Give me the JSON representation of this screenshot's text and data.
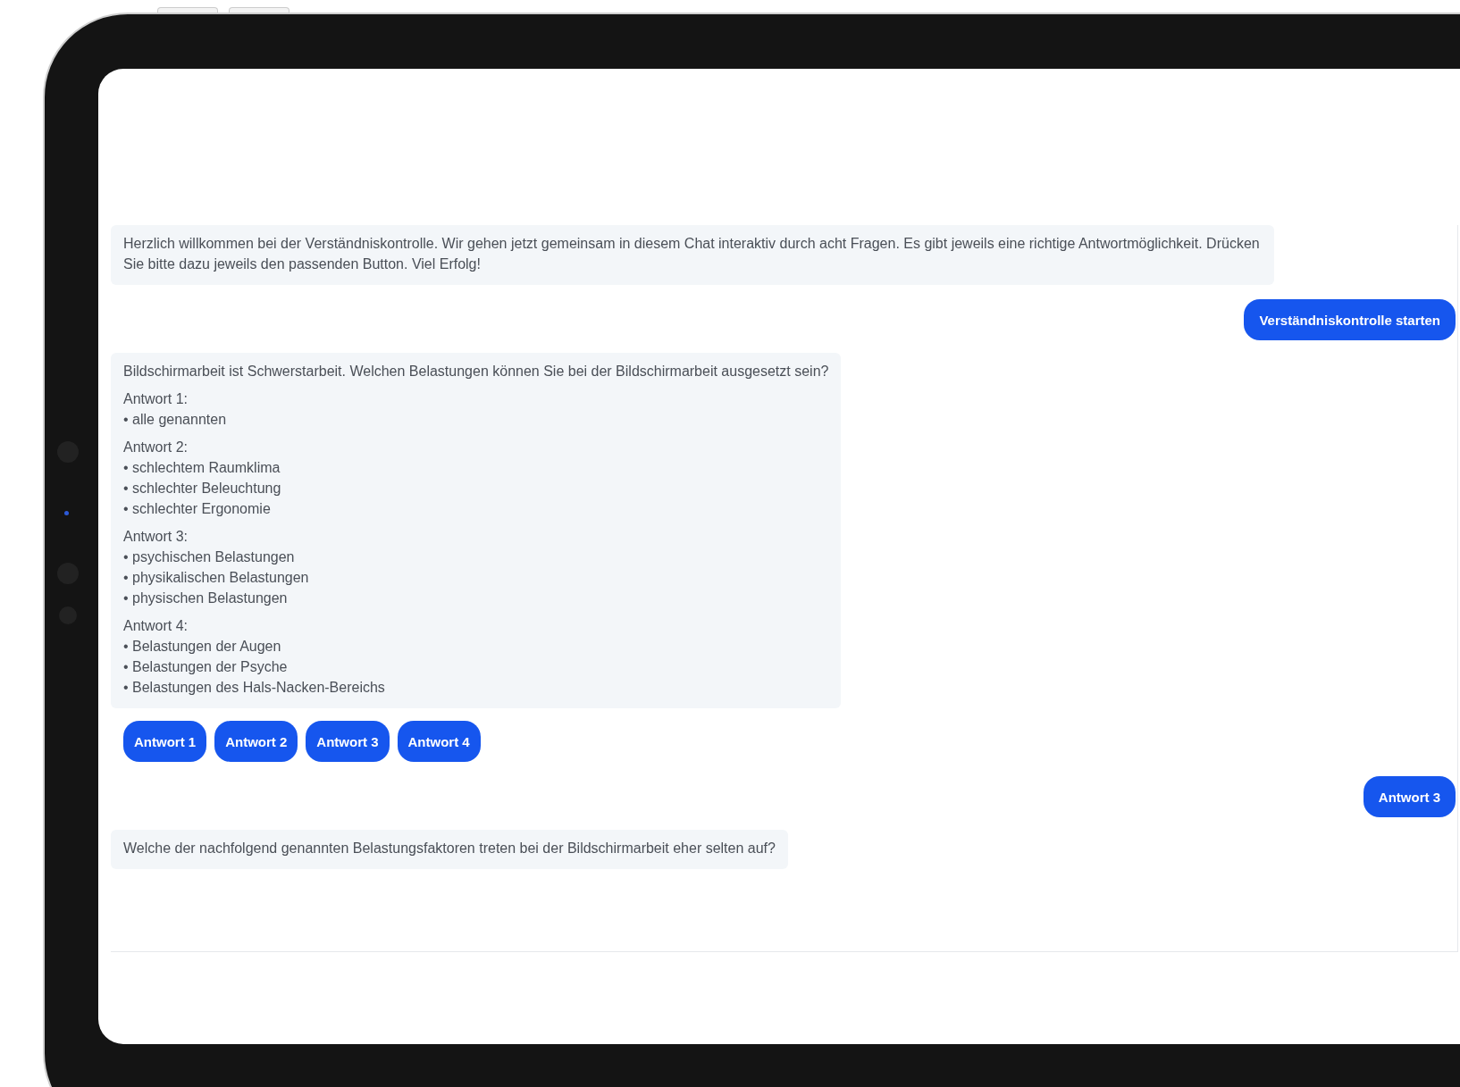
{
  "chat": {
    "messages": [
      {
        "kind": "intro",
        "text": "Herzlich willkommen bei der Verständniskontrolle. Wir gehen jetzt gemeinsam in diesem Chat interaktiv durch acht Fragen. Es gibt jeweils eine richtige Antwortmöglichkeit. Drücken Sie bitte dazu jeweils den passenden Button. Viel Erfolg!"
      },
      {
        "kind": "user",
        "text": "Verständniskontrolle starten"
      },
      {
        "kind": "question",
        "text": "Bildschirmarbeit ist Schwerstarbeit. Welchen Belastungen können Sie bei der Bildschirmarbeit ausgesetzt sein?",
        "answers": [
          {
            "label": "Antwort 1:",
            "items": [
              "• alle genannten"
            ]
          },
          {
            "label": "Antwort 2:",
            "items": [
              "• schlechtem Raumklima",
              "• schlechter Beleuchtung",
              "• schlechter Ergonomie"
            ]
          },
          {
            "label": "Antwort 3:",
            "items": [
              "• psychischen Belastungen",
              "• physikalischen Belastungen",
              "• physischen Belastungen"
            ]
          },
          {
            "label": "Antwort 4:",
            "items": [
              "• Belastungen der Augen",
              "• Belastungen der Psyche",
              "• Belastungen des Hals-Nacken-Bereichs"
            ]
          }
        ]
      },
      {
        "kind": "choices",
        "buttons": [
          "Antwort 1",
          "Antwort 2",
          "Antwort 3",
          "Antwort 4"
        ]
      },
      {
        "kind": "user",
        "text": "Antwort 3"
      },
      {
        "kind": "question",
        "text": "Welche der nachfolgend genannten Belastungsfaktoren treten bei der Bildschirmarbeit eher selten auf?"
      }
    ]
  }
}
